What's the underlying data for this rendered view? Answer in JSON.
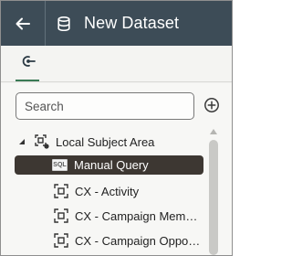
{
  "header": {
    "title": "New Dataset",
    "back_icon": "arrow-left-icon",
    "dataset_icon": "database-icon",
    "background": "#3d4c57"
  },
  "tabs": [
    {
      "icon": "data-source-icon",
      "active": true
    }
  ],
  "search": {
    "placeholder": "Search",
    "value": ""
  },
  "add_button": {
    "icon": "add-circle-icon"
  },
  "tree": {
    "root": {
      "label": "Local Subject Area",
      "expanded": true,
      "icon": "subject-area-icon"
    },
    "children": [
      {
        "label": "Manual Query",
        "icon": "sql-icon",
        "badge": "SQL",
        "selected": true
      },
      {
        "label": "CX - Activity",
        "icon": "subject-area-icon",
        "selected": false
      },
      {
        "label": "CX - Campaign Mem…",
        "icon": "subject-area-icon",
        "selected": false
      },
      {
        "label": "CX - Campaign Oppo…",
        "icon": "subject-area-icon",
        "selected": false
      }
    ]
  },
  "colors": {
    "accent": "#3a7a55",
    "selected_bg": "#3d3732"
  }
}
